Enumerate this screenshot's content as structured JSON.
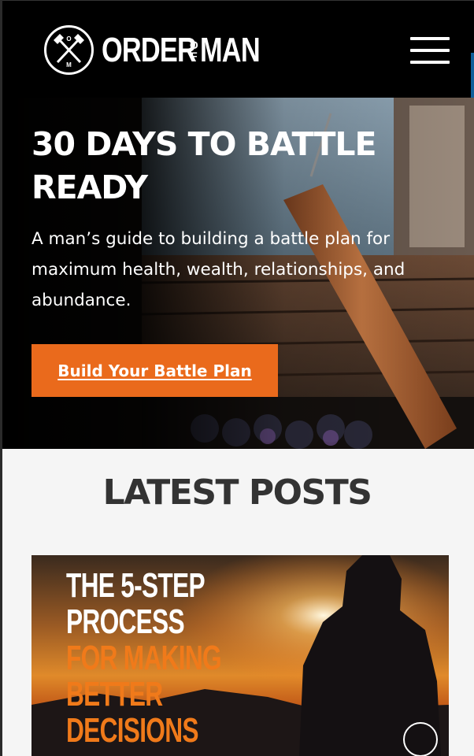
{
  "header": {
    "logo_word_1": "ORDER",
    "logo_of_o": "O",
    "logo_of_f": "F",
    "logo_word_2": "MAN",
    "menu_icon": "hamburger-icon"
  },
  "hero": {
    "title": "30 DAYS TO BATTLE READY",
    "subtitle": "A man’s guide to building a battle plan for maximum health, wealth, relationships, and abundance.",
    "cta_label": "Build Your Battle Plan",
    "cta_color": "#ea6a1c"
  },
  "latest": {
    "heading": "LATEST POSTS",
    "post": {
      "lines": [
        {
          "text": "THE 5-STEP",
          "color": "white"
        },
        {
          "text": "PROCESS",
          "color": "white"
        },
        {
          "text": "FOR MAKING",
          "color": "orange"
        },
        {
          "text": "BETTER",
          "color": "orange"
        },
        {
          "text": "DECISIONS",
          "color": "orange"
        }
      ]
    }
  }
}
